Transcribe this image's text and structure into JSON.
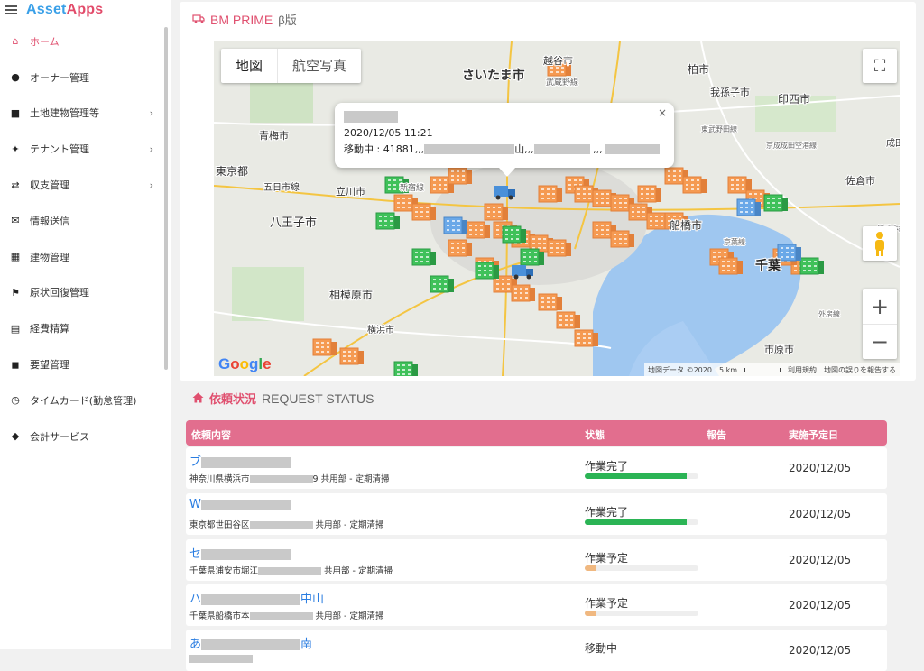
{
  "app": {
    "brand": [
      "Asset",
      "Apps"
    ]
  },
  "sidebar": {
    "items": [
      {
        "label": "ホーム",
        "icon": "home-icon",
        "active": true
      },
      {
        "label": "オーナー管理",
        "icon": "person-icon"
      },
      {
        "label": "土地建物管理等",
        "icon": "land-icon",
        "chevron": true
      },
      {
        "label": "テナント管理",
        "icon": "tenant-icon",
        "chevron": true
      },
      {
        "label": "収支管理",
        "icon": "exchange-icon",
        "chevron": true
      },
      {
        "label": "情報送信",
        "icon": "send-icon"
      },
      {
        "label": "建物管理",
        "icon": "building-icon"
      },
      {
        "label": "原状回復管理",
        "icon": "restore-icon"
      },
      {
        "label": "経費精算",
        "icon": "calculator-icon"
      },
      {
        "label": "要望管理",
        "icon": "request-icon"
      },
      {
        "label": "タイムカード(勤怠管理)",
        "icon": "clock-icon"
      },
      {
        "label": "会計サービス",
        "icon": "accounting-icon"
      }
    ]
  },
  "map_section": {
    "title": "BM PRIME",
    "subtitle": "β版",
    "map_type": [
      "地図",
      "航空写真"
    ],
    "zoom_in": "+",
    "zoom_out": "−",
    "infowindow": {
      "datetime": "2020/12/05 11:21",
      "status_prefix": "移動中 : 41881,,,",
      "status_mid": "山,,,",
      "close": "×"
    },
    "labels": [
      "さいたま市",
      "越谷市",
      "柏市",
      "我孫子市",
      "印西市",
      "青梅市",
      "東京都",
      "五日市線",
      "立川市",
      "八王子市",
      "相模原市",
      "横浜市",
      "船橋市",
      "千葉",
      "市原市",
      "佐倉市",
      "成田市",
      "武蔵野線",
      "新宿線",
      "京成成田空港線",
      "東武野田線",
      "外房線",
      "京葉線",
      "総武本線"
    ],
    "google": "Google",
    "attribution": {
      "data": "地図データ ©2020",
      "scale": "5 km",
      "terms": "利用規約",
      "report": "地図の誤りを報告する"
    }
  },
  "request_section": {
    "title": "依頼状況",
    "subtitle": "REQUEST STATUS",
    "columns": [
      "依頼内容",
      "状態",
      "報告",
      "実施予定日"
    ],
    "rows": [
      {
        "name_visible": "ブ",
        "address_prefix": "神奈川県横浜市",
        "address_suffix": "9 共用部 - 定期清掃",
        "status": "作業完了",
        "progress": 0.9,
        "date": "2020/12/05"
      },
      {
        "name_visible": "W",
        "address_prefix": "東京都世田谷区",
        "address_suffix": " 共用部 - 定期清掃",
        "status": "作業完了",
        "progress": 0.9,
        "date": "2020/12/05"
      },
      {
        "name_visible": "セ",
        "address_prefix": "千葉県浦安市堀江",
        "address_suffix": " 共用部 - 定期清掃",
        "status": "作業予定",
        "progress": 0.1,
        "date": "2020/12/05"
      },
      {
        "name_visible": "ハ",
        "name_suffix": "中山",
        "address_prefix": "千葉県船橋市本",
        "address_suffix": " 共用部 - 定期清掃",
        "status": "作業予定",
        "progress": 0.1,
        "date": "2020/12/05"
      },
      {
        "name_visible": "あ",
        "name_suffix": "南",
        "address_prefix": "",
        "address_suffix": "",
        "status": "移動中",
        "progress": 0,
        "date": "2020/12/05"
      }
    ]
  },
  "colors": {
    "accent": "#e0506f",
    "header": "#e26e8e",
    "done": "#2bb455",
    "planned": "#f0b880",
    "link": "#2a7de1"
  }
}
